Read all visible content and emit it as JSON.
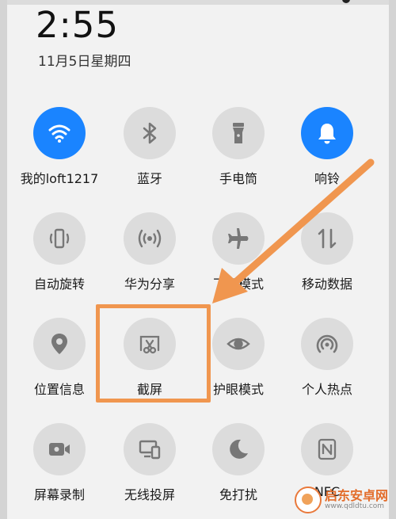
{
  "status": {
    "time": "2:55",
    "date": "11月5日星期四"
  },
  "colors": {
    "accent_on": "#1a84ff",
    "tile_off": "#dcdcdc",
    "highlight": "#f0964f"
  },
  "tiles": [
    {
      "label": "我的loft1217",
      "icon": "wifi-icon",
      "active": true
    },
    {
      "label": "蓝牙",
      "icon": "bluetooth-icon",
      "active": false
    },
    {
      "label": "手电筒",
      "icon": "flashlight-icon",
      "active": false
    },
    {
      "label": "响铃",
      "icon": "bell-icon",
      "active": true
    },
    {
      "label": "自动旋转",
      "icon": "auto-rotate-icon",
      "active": false
    },
    {
      "label": "华为分享",
      "icon": "huawei-share-icon",
      "active": false
    },
    {
      "label": "飞行模式",
      "icon": "airplane-icon",
      "active": false
    },
    {
      "label": "移动数据",
      "icon": "mobile-data-icon",
      "active": false
    },
    {
      "label": "位置信息",
      "icon": "location-icon",
      "active": false
    },
    {
      "label": "截屏",
      "icon": "screenshot-icon",
      "active": false
    },
    {
      "label": "护眼模式",
      "icon": "eye-comfort-icon",
      "active": false
    },
    {
      "label": "个人热点",
      "icon": "hotspot-icon",
      "active": false
    },
    {
      "label": "屏幕录制",
      "icon": "screen-record-icon",
      "active": false
    },
    {
      "label": "无线投屏",
      "icon": "wireless-projection-icon",
      "active": false
    },
    {
      "label": "免打扰",
      "icon": "do-not-disturb-icon",
      "active": false
    },
    {
      "label": "NFC",
      "icon": "nfc-icon",
      "active": false
    }
  ],
  "watermark": {
    "name": "启东安卓网",
    "url": "www.qdldtu.com"
  }
}
